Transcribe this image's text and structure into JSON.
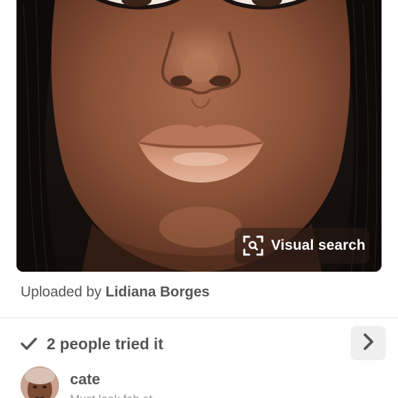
{
  "pin": {
    "image_alt": "Close-up portrait photo of a woman's face showing lip makeup",
    "visual_search_label": "Visual search",
    "visual_search_icon": "scan-search-icon"
  },
  "attribution": {
    "prefix": "Uploaded by",
    "uploader": "Lidiana Borges"
  },
  "tried_it": {
    "icon": "check-icon",
    "label": "2 people tried it",
    "next_icon": "chevron-right-icon",
    "entries": [
      {
        "name": "cate",
        "comment": "Must look fab at..."
      }
    ]
  },
  "colors": {
    "text_gray": "#555555",
    "button_bg": "#efefef",
    "overlay_bg": "#2b1c16"
  }
}
